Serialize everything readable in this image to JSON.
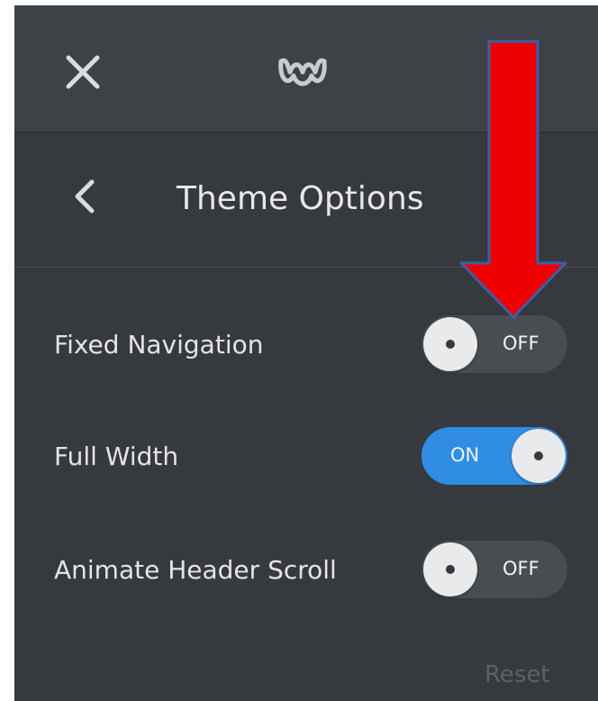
{
  "topbar": {
    "close_icon": "close-icon",
    "logo_icon": "weebly-logo-icon"
  },
  "header": {
    "back_icon": "chevron-left-icon",
    "title": "Theme Options"
  },
  "options": [
    {
      "label": "Fixed Navigation",
      "state": "OFF",
      "enabled": false
    },
    {
      "label": "Full Width",
      "state": "ON",
      "enabled": true
    },
    {
      "label": "Animate Header Scroll",
      "state": "OFF",
      "enabled": false
    }
  ],
  "footer": {
    "reset_label": "Reset"
  },
  "annotation": {
    "arrow_icon": "down-arrow-annotation-icon",
    "color": "#ee0000",
    "outline_color": "#3a5fa8"
  },
  "colors": {
    "panel_bg": "#36393d",
    "topbar_bg": "#3e4246",
    "toggle_on": "#2f8ee3",
    "toggle_off": "#494d52"
  }
}
